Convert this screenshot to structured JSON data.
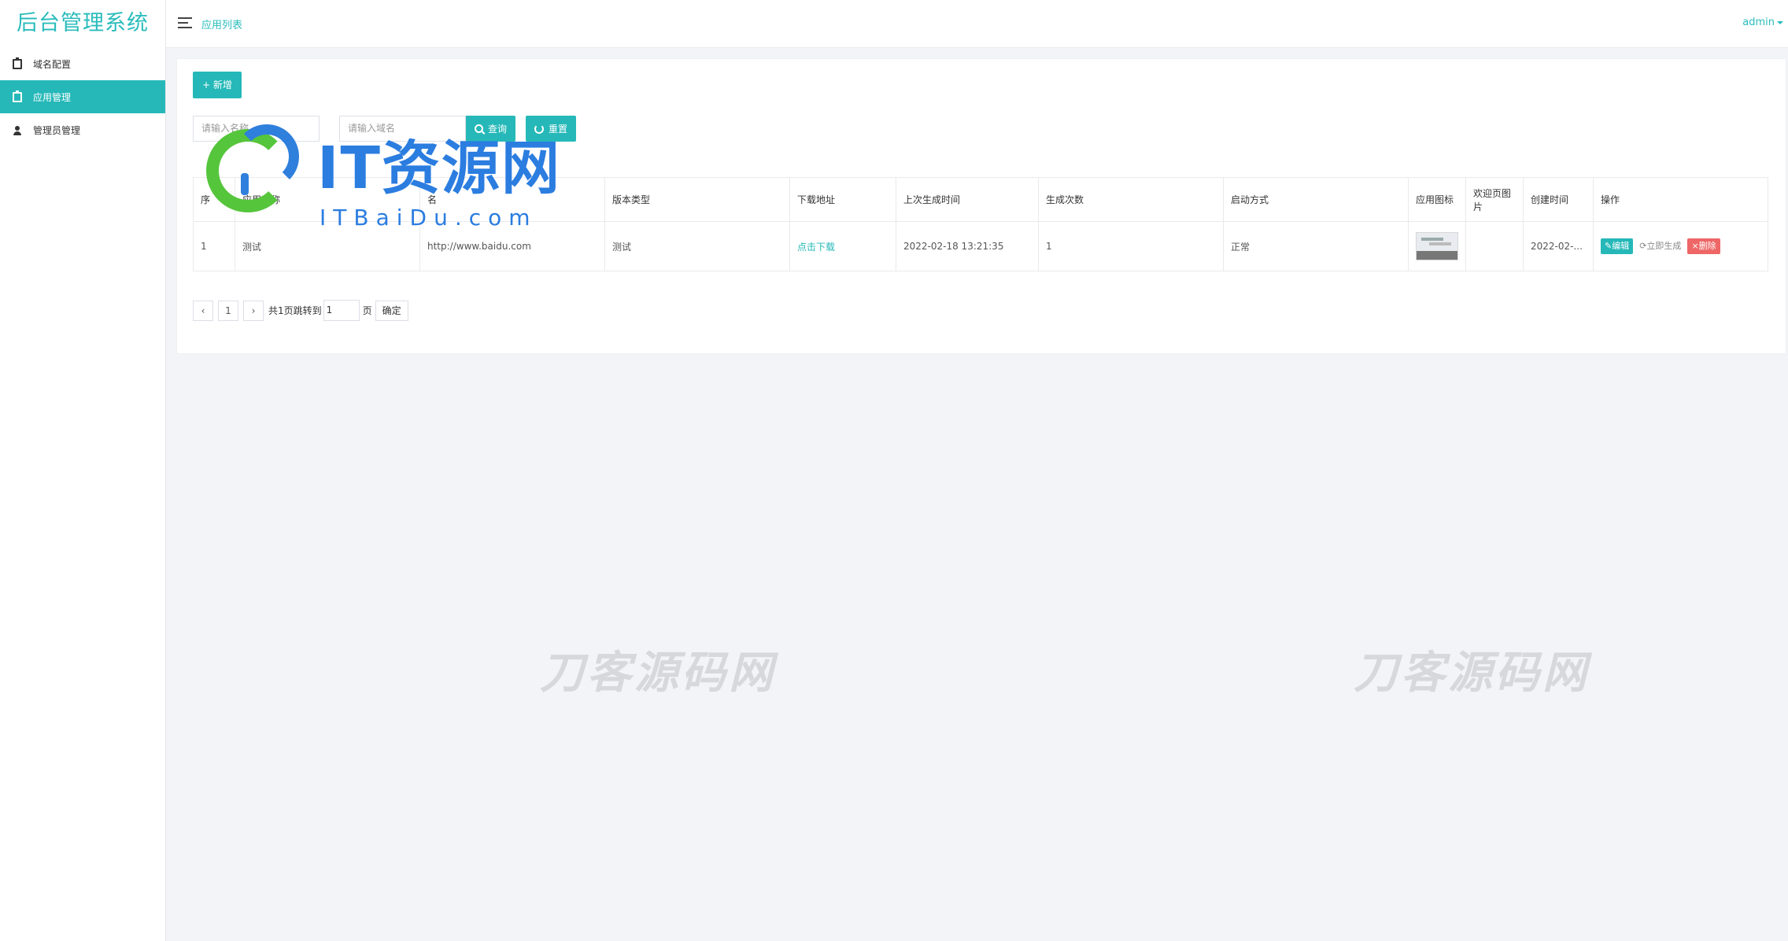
{
  "app": {
    "title": "后台管理系统"
  },
  "sidebar": {
    "items": [
      {
        "label": "域名配置",
        "icon": "clipboard-icon"
      },
      {
        "label": "应用管理",
        "icon": "clipboard-icon",
        "active": true
      },
      {
        "label": "管理员管理",
        "icon": "user-icon"
      }
    ]
  },
  "header": {
    "breadcrumb": "应用列表",
    "user": "admin"
  },
  "toolbar": {
    "add_label": "+ 新增"
  },
  "search": {
    "name_placeholder": "请输入名称",
    "domain_placeholder": "请输入域名",
    "query_label": "查询",
    "reset_label": "重置"
  },
  "table": {
    "columns": [
      "序",
      "应用名称",
      "名",
      "版本类型",
      "下载地址",
      "上次生成时间",
      "生成次数",
      "启动方式",
      "应用图标",
      "欢迎页图片",
      "创建时间",
      "操作"
    ],
    "rows": [
      {
        "index": "1",
        "name": "测试",
        "domain": "http://www.baidu.com",
        "version_type": "测试",
        "download": "点击下载",
        "last_generated": "2022-02-18 13:21:35",
        "count": "1",
        "launch_mode": "正常",
        "created": "2022-02-...",
        "actions": {
          "edit": "编辑",
          "generate": "立即生成",
          "delete": "删除"
        }
      }
    ]
  },
  "pagination": {
    "prev": "‹",
    "page": "1",
    "next": "›",
    "info": "共1页跳转到",
    "goto_value": "1",
    "page_unit": "页",
    "confirm": "确定"
  },
  "watermarks": {
    "logo_title": "IT资源网",
    "logo_sub": "ITBaiDu.com",
    "text": "刀客源码网"
  },
  "colors": {
    "accent": "#26b8b8",
    "danger": "#ee6666",
    "background": "#f3f4f7"
  }
}
